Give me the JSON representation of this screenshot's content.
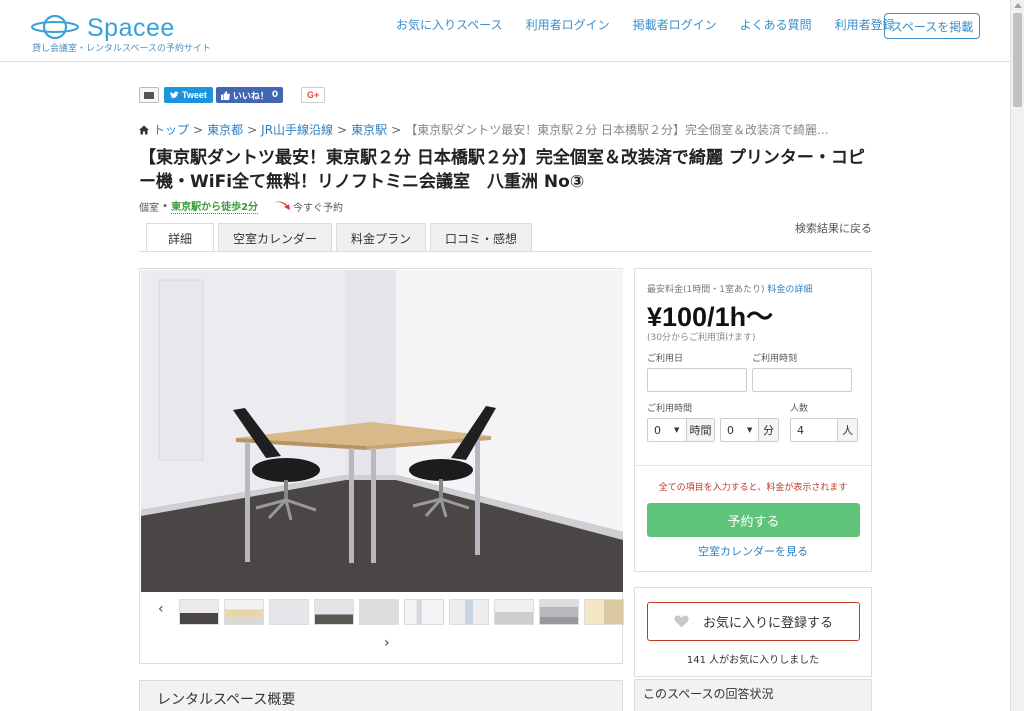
{
  "header": {
    "logo_text": "Spacee",
    "logo_sub": "貸し会議室・レンタルスペースの予約サイト",
    "nav": [
      "お気に入りスペース",
      "利用者ログイン",
      "掲載者ログイン",
      "よくある質問",
      "利用者登録"
    ],
    "cta": "スペースを掲載"
  },
  "share": {
    "tweet": "Tweet",
    "like": "いいね！",
    "like_count": "0",
    "gplus": "G+"
  },
  "breadcrumb": {
    "items": [
      "トップ",
      "東京都",
      "JR山手線沿線",
      "東京駅"
    ],
    "separator": ">",
    "current": "【東京駅ダントツ最安！東京駅２分 日本橋駅２分】完全個室＆改装済で綺麗..."
  },
  "title": "【東京駅ダントツ最安！東京駅２分 日本橋駅２分】完全個室＆改装済で綺麗 プリンター・コピー機・WiFi全て無料！リノフトミニ会議室　八重洲 No③",
  "subline": {
    "type": "個室",
    "walk": "東京駅から徒歩2分",
    "quick": "今すぐ予約"
  },
  "tabs": [
    "詳細",
    "空室カレンダー",
    "料金プラン",
    "口コミ・感想"
  ],
  "back_link": "検索結果に戻る",
  "gallery": {
    "prev": "‹",
    "next": "›",
    "thumb_count": 10
  },
  "booking": {
    "min_price_label": "最安料金(1時間・1室あたり)",
    "price_detail_link": "料金の詳細",
    "price": "¥100/1h〜",
    "price_note": "(30分からご利用頂けます)",
    "date_label": "ご利用日",
    "time_label": "ご利用時刻",
    "duration_label": "ご利用時間",
    "people_label": "人数",
    "hours_value": "0",
    "hours_unit": "時間",
    "minutes_value": "0",
    "minutes_unit": "分",
    "people_value": "4",
    "people_unit": "人",
    "hint": "全ての項目を入力すると、料金が表示されます",
    "reserve_button": "予約する",
    "calendar_link": "空室カレンダーを見る"
  },
  "favorite": {
    "button": "お気に入りに登録する",
    "count_text": "141 人がお気に入りしました"
  },
  "sections": {
    "overview": "レンタルスペース概要",
    "answers": "このスペースの回答状況"
  },
  "colors": {
    "brand": "#3aa0d8",
    "link": "#2f7fc0",
    "reserve": "#5fc47a",
    "alert": "#c0392b"
  }
}
